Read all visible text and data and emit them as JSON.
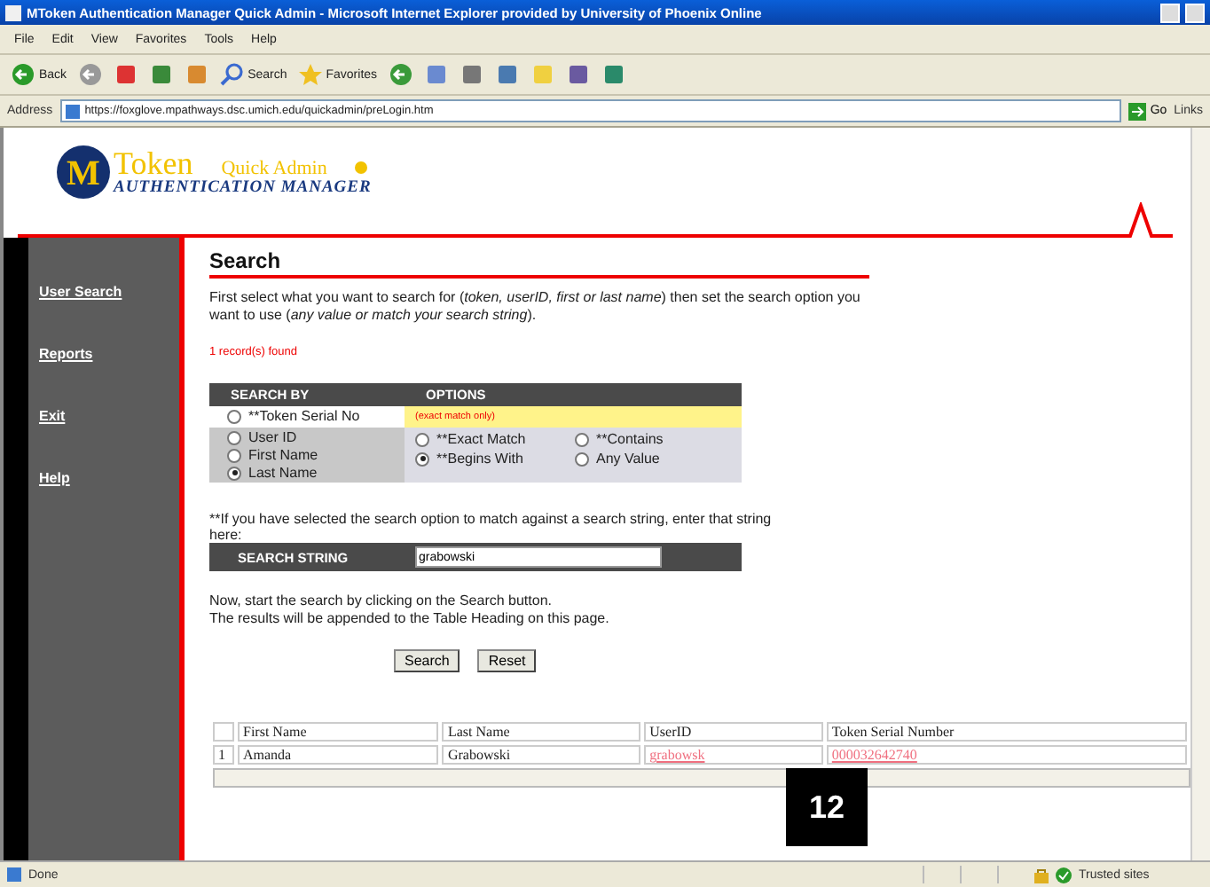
{
  "window": {
    "title": "MToken Authentication Manager Quick Admin - Microsoft Internet Explorer provided by University of Phoenix Online"
  },
  "menu": [
    "File",
    "Edit",
    "View",
    "Favorites",
    "Tools",
    "Help"
  ],
  "toolbar": [
    {
      "kind": "back",
      "label": "Back"
    },
    {
      "kind": "forward"
    },
    {
      "kind": "stop"
    },
    {
      "kind": "refresh"
    },
    {
      "kind": "home"
    },
    {
      "kind": "search",
      "label": "Search"
    },
    {
      "kind": "favorites",
      "label": "Favorites"
    },
    {
      "kind": "history"
    },
    {
      "kind": "mail"
    },
    {
      "kind": "print"
    },
    {
      "kind": "edit"
    },
    {
      "kind": "note"
    },
    {
      "kind": "book"
    },
    {
      "kind": "messenger"
    }
  ],
  "address": {
    "label": "Address",
    "url": "https://foxglove.mpathways.dsc.umich.edu/quickadmin/preLogin.htm",
    "go": "Go",
    "links": "Links"
  },
  "logo": {
    "mark": "M",
    "word": "Token",
    "product": "Quick Admin",
    "subtitle": "AUTHENTICATION MANAGER"
  },
  "sidebar": [
    {
      "label": "User Search"
    },
    {
      "label": "Reports"
    },
    {
      "label": "Exit"
    },
    {
      "label": "Help"
    }
  ],
  "search": {
    "heading": "Search",
    "intro": "First select what you want to search for (*token, userID, first or last name*) then set the search option you want to use (*any value or match your search string*).",
    "records": "1 record(s) found",
    "headers": [
      "SEARCH BY",
      "OPTIONS"
    ],
    "token_option": {
      "label": "**Token Serial No",
      "selected": false,
      "note": "(exact match only)"
    },
    "search_by": [
      {
        "label": "User ID",
        "selected": false
      },
      {
        "label": "First Name",
        "selected": false
      },
      {
        "label": "Last Name",
        "selected": true
      }
    ],
    "options": [
      {
        "label": "**Exact Match",
        "selected": false
      },
      {
        "label": "**Contains",
        "selected": false
      },
      {
        "label": "**Begins With",
        "selected": true
      },
      {
        "label": "Any Value",
        "selected": false
      }
    ],
    "hint": "**If you have selected the search option to match against a search string, enter that string here:",
    "search_string": {
      "label": "SEARCH STRING",
      "value": "grabowski"
    },
    "instructions": [
      "Now, start the search by clicking on the Search button.",
      "The results will be appended to the Table Heading on this page."
    ],
    "buttons": [
      "Search",
      "Reset"
    ]
  },
  "results": {
    "columns": [
      "First Name",
      "Last Name",
      "UserID",
      "Token Serial Number"
    ],
    "rows": [
      {
        "number": "1",
        "cells": [
          {
            "text": "Amanda",
            "kind": "text"
          },
          {
            "text": "Grabowski",
            "kind": "text"
          },
          {
            "text": "grabowsk",
            "kind": "link"
          },
          {
            "text": "000032642740",
            "kind": "link"
          }
        ]
      }
    ]
  },
  "badge": "12",
  "status": {
    "text": "Done",
    "zone": "Trusted sites"
  }
}
